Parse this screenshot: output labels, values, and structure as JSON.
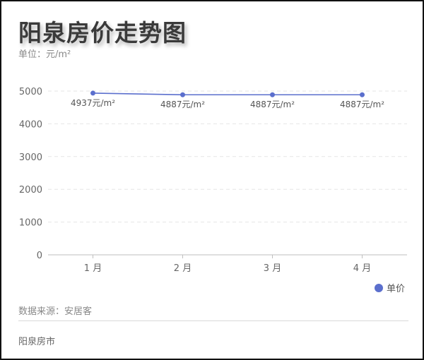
{
  "title": "阳泉房价走势图",
  "unit_label": "单位：元/m²",
  "source": "数据来源：安居客",
  "footer": "阳泉房市",
  "colors": {
    "series": "#5b6fcd",
    "axis_text": "#666666",
    "grid": "#e6e6e6"
  },
  "chart_data": {
    "type": "line",
    "categories": [
      "1 月",
      "2 月",
      "3 月",
      "4 月"
    ],
    "series": [
      {
        "name": "单价",
        "values": [
          4937,
          4887,
          4887,
          4887
        ],
        "data_labels": [
          "4937元/m²",
          "4887元/m²",
          "4887元/m²",
          "4887元/m²"
        ]
      }
    ],
    "yticks": [
      0,
      1000,
      2000,
      3000,
      4000,
      5000
    ],
    "ylim": [
      0,
      5000
    ],
    "grid": true,
    "legend_position": "bottom-right"
  }
}
